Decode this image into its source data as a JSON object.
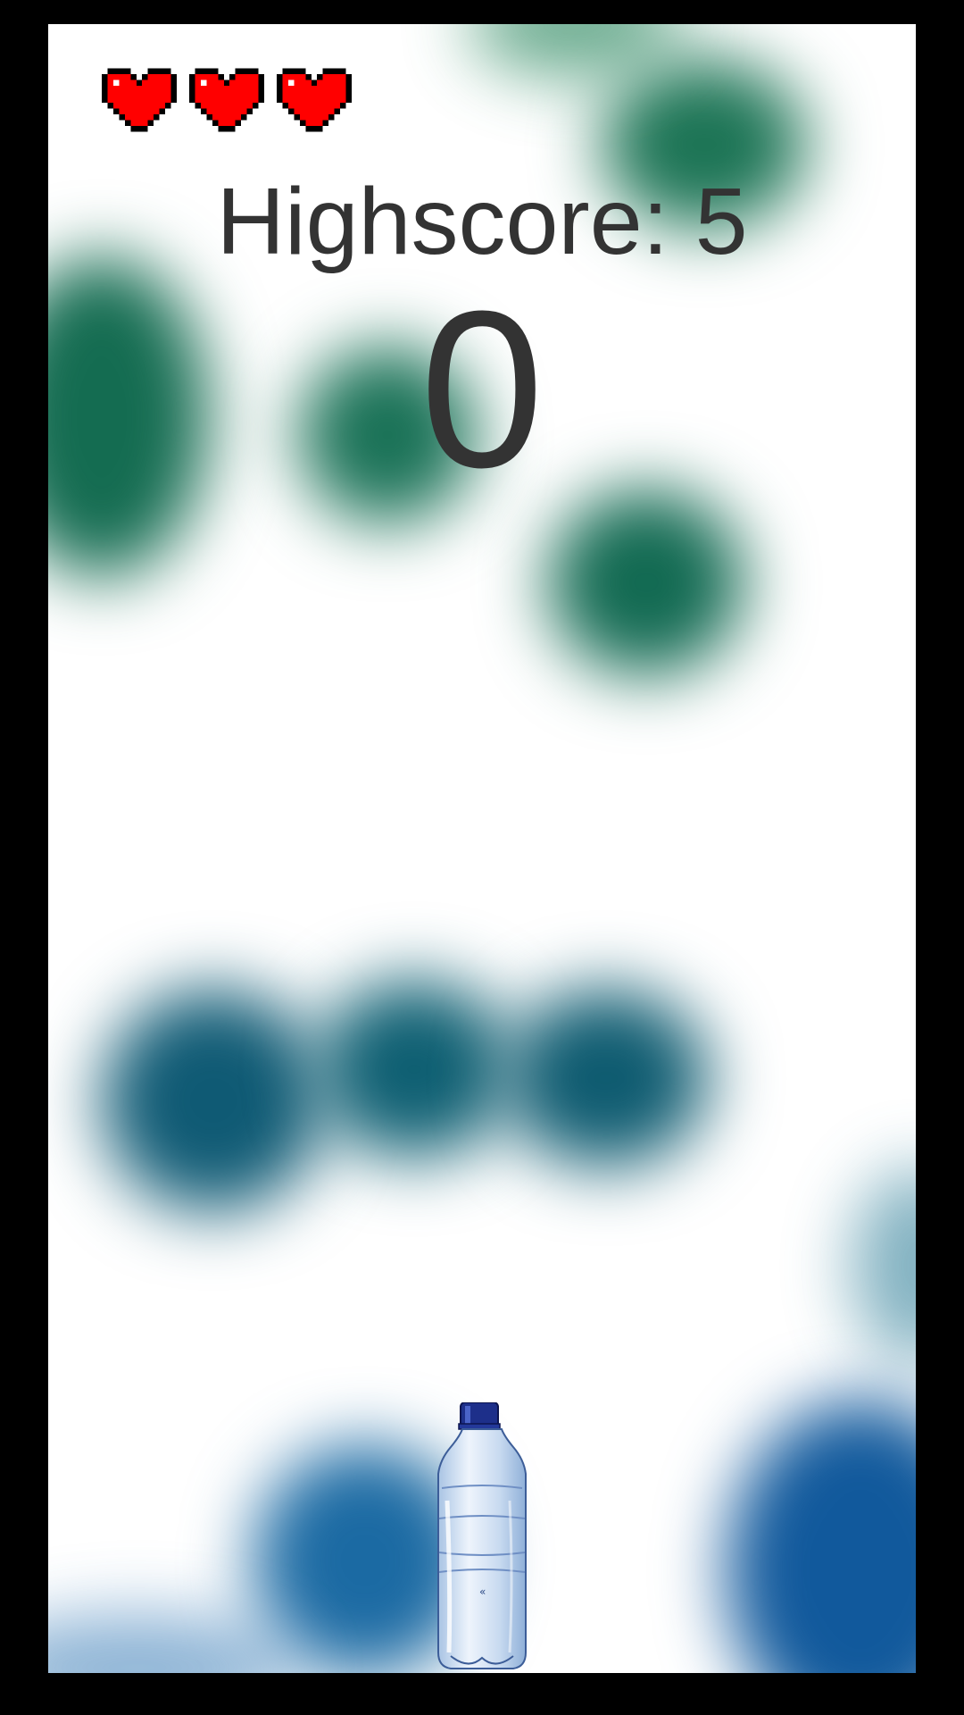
{
  "hud": {
    "lives": 3,
    "highscore_text": "Highscore: 5",
    "score": "0"
  },
  "icons": {
    "heart": "heart-icon",
    "bottle": "water-bottle-icon"
  },
  "colors": {
    "heart": "#ff0000",
    "text": "#333333",
    "green_blob": "#0e6b4d",
    "teal_blob": "#0e5a6e",
    "blue_blob": "#0f5c9e"
  }
}
